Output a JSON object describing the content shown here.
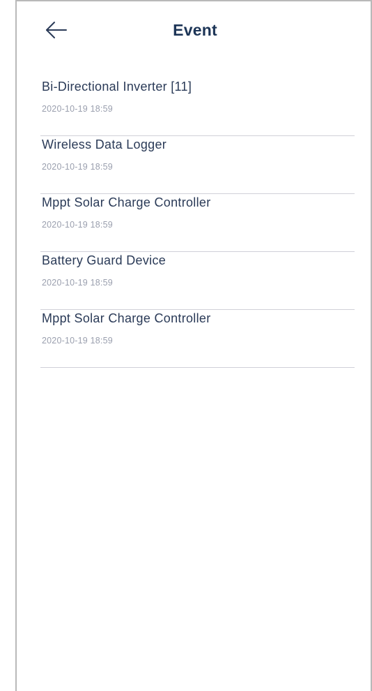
{
  "header": {
    "back_icon": "arrow-left-icon",
    "title": "Event"
  },
  "events": [
    {
      "name": "Bi-Directional Inverter [11]",
      "time": "2020-10-19 18:59"
    },
    {
      "name": "Wireless Data Logger",
      "time": "2020-10-19 18:59"
    },
    {
      "name": "Mppt Solar Charge Controller",
      "time": "2020-10-19 18:59"
    },
    {
      "name": "Battery Guard Device",
      "time": "2020-10-19 18:59"
    },
    {
      "name": "Mppt Solar Charge Controller",
      "time": "2020-10-19 18:59"
    }
  ],
  "colors": {
    "title": "#1d3557",
    "item_text": "#2a3a57",
    "timestamp": "#9a9fae",
    "divider": "#d0d0d8"
  }
}
